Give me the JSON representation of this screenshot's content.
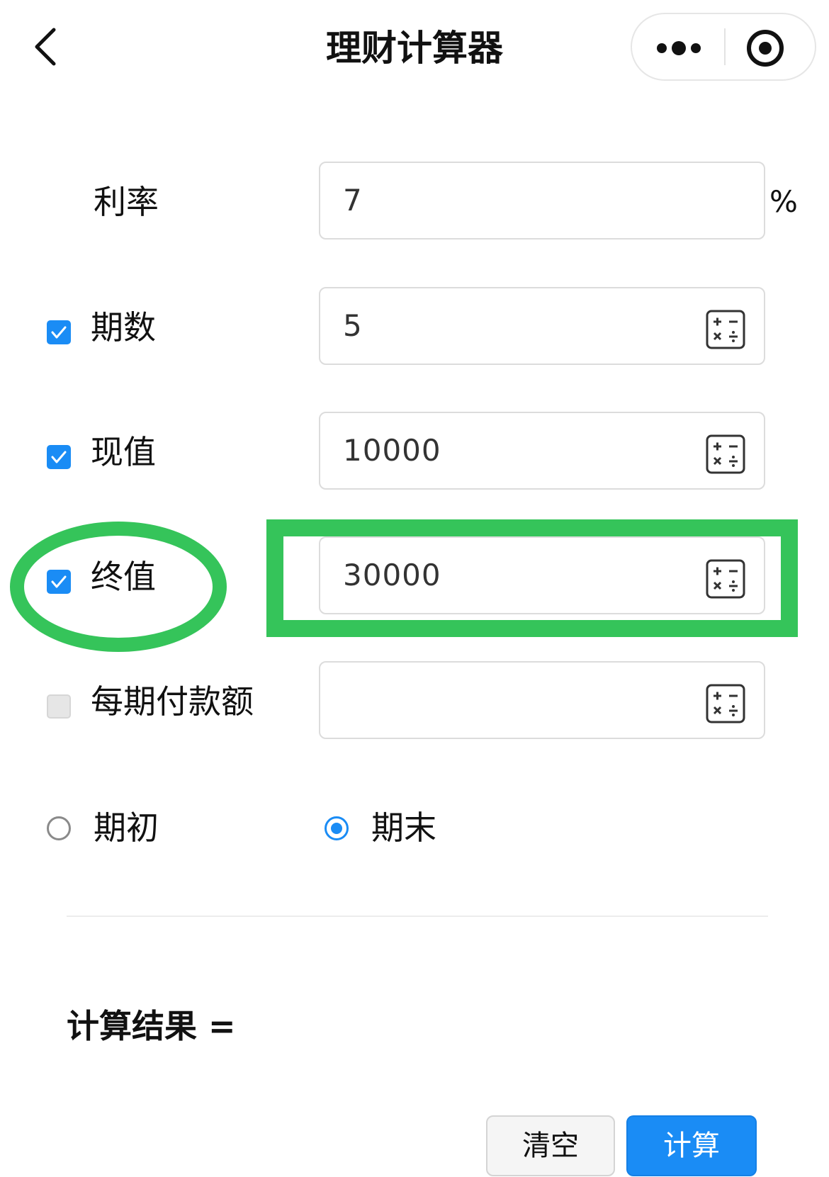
{
  "nav": {
    "title": "理财计算器"
  },
  "form": {
    "rate": {
      "label": "利率",
      "value": "7",
      "unit": "%"
    },
    "periods": {
      "label": "期数",
      "value": "5",
      "checked": true
    },
    "present_value": {
      "label": "现值",
      "value": "10000",
      "checked": true
    },
    "future_value": {
      "label": "终值",
      "value": "30000",
      "checked": true
    },
    "payment": {
      "label": "每期付款额",
      "value": "",
      "checked": false
    },
    "timing": {
      "options": [
        {
          "label": "期初",
          "selected": false
        },
        {
          "label": "期末",
          "selected": true
        }
      ]
    }
  },
  "result": {
    "label": "计算结果 ="
  },
  "buttons": {
    "clear": "清空",
    "calculate": "计算"
  },
  "colors": {
    "accent": "#1a8cf5",
    "highlight": "#35c45a",
    "border": "#dcdcdc"
  },
  "icons": {
    "back": "chevron-left-icon",
    "more": "more-dots-icon",
    "close": "target-circle-icon",
    "calculator": "calculator-icon",
    "check": "check-icon"
  }
}
